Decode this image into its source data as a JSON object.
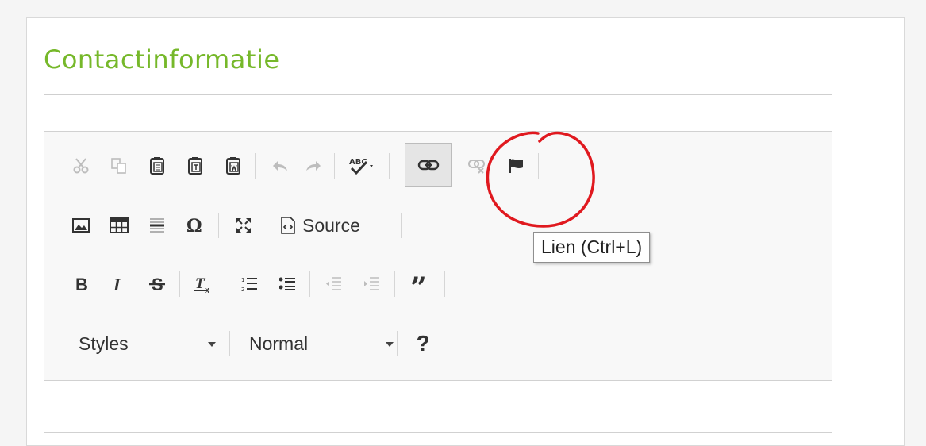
{
  "section": {
    "title": "Contactinformatie"
  },
  "toolbar": {
    "row1": [
      "Couper",
      "Copier",
      "Coller",
      "Coller comme texte sans mise en forme",
      "Coller depuis Word",
      "Annuler",
      "Rétablir",
      "Vérification orthographique",
      "Lien",
      "Supprimer le lien",
      "Ancre"
    ],
    "source_label": "Source",
    "styles_label": "Styles",
    "format_label": "Normal",
    "help_label": "?"
  },
  "tooltip": {
    "text": "Lien (Ctrl+L)"
  },
  "colors": {
    "accent": "#76b82a",
    "annotation": "#e0191f",
    "icon": "#333333",
    "icon_disabled": "#bdbdbd"
  }
}
